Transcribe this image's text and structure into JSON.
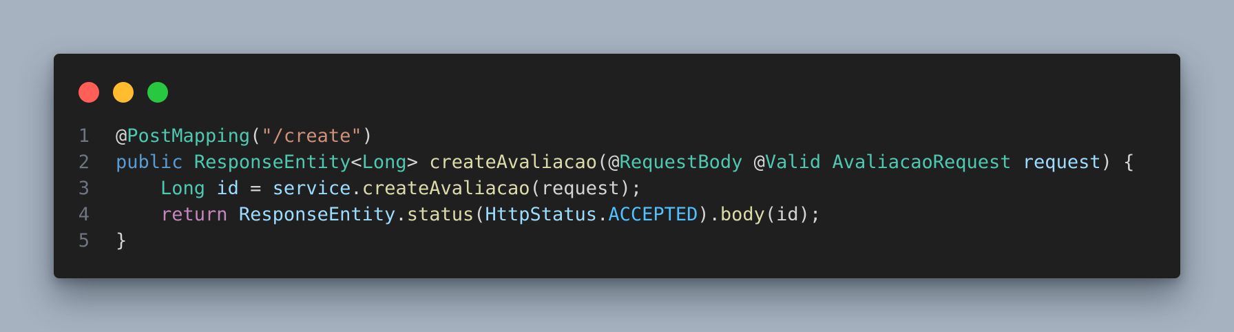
{
  "window": {
    "controls": [
      {
        "name": "close",
        "color": "#ff5f57"
      },
      {
        "name": "minimize",
        "color": "#febc2e"
      },
      {
        "name": "zoom",
        "color": "#28c840"
      }
    ]
  },
  "code": {
    "lines": [
      {
        "number": "1",
        "tokens": [
          {
            "text": "@",
            "color": "#d4d4d4"
          },
          {
            "text": "PostMapping",
            "color": "#4ec9b0"
          },
          {
            "text": "(",
            "color": "#d4d4d4"
          },
          {
            "text": "\"/create\"",
            "color": "#ce9178"
          },
          {
            "text": ")",
            "color": "#d4d4d4"
          }
        ]
      },
      {
        "number": "2",
        "tokens": [
          {
            "text": "public",
            "color": "#569cd6"
          },
          {
            "text": " ",
            "color": "#d4d4d4"
          },
          {
            "text": "ResponseEntity",
            "color": "#4ec9b0"
          },
          {
            "text": "<",
            "color": "#d4d4d4"
          },
          {
            "text": "Long",
            "color": "#4ec9b0"
          },
          {
            "text": "> ",
            "color": "#d4d4d4"
          },
          {
            "text": "createAvaliacao",
            "color": "#dcdcaa"
          },
          {
            "text": "(@",
            "color": "#d4d4d4"
          },
          {
            "text": "RequestBody",
            "color": "#4ec9b0"
          },
          {
            "text": " @",
            "color": "#d4d4d4"
          },
          {
            "text": "Valid",
            "color": "#4ec9b0"
          },
          {
            "text": " ",
            "color": "#d4d4d4"
          },
          {
            "text": "AvaliacaoRequest",
            "color": "#4ec9b0"
          },
          {
            "text": " ",
            "color": "#d4d4d4"
          },
          {
            "text": "request",
            "color": "#9cdcfe"
          },
          {
            "text": ") {",
            "color": "#d4d4d4"
          }
        ]
      },
      {
        "number": "3",
        "tokens": [
          {
            "text": "    ",
            "color": "#d4d4d4"
          },
          {
            "text": "Long",
            "color": "#4ec9b0"
          },
          {
            "text": " ",
            "color": "#d4d4d4"
          },
          {
            "text": "id",
            "color": "#9cdcfe"
          },
          {
            "text": " = ",
            "color": "#d4d4d4"
          },
          {
            "text": "service",
            "color": "#9cdcfe"
          },
          {
            "text": ".",
            "color": "#d4d4d4"
          },
          {
            "text": "createAvaliacao",
            "color": "#dcdcaa"
          },
          {
            "text": "(request);",
            "color": "#d4d4d4"
          }
        ]
      },
      {
        "number": "4",
        "tokens": [
          {
            "text": "    ",
            "color": "#d4d4d4"
          },
          {
            "text": "return",
            "color": "#c586c0"
          },
          {
            "text": " ",
            "color": "#d4d4d4"
          },
          {
            "text": "ResponseEntity",
            "color": "#9cdcfe"
          },
          {
            "text": ".",
            "color": "#d4d4d4"
          },
          {
            "text": "status",
            "color": "#dcdcaa"
          },
          {
            "text": "(",
            "color": "#d4d4d4"
          },
          {
            "text": "HttpStatus",
            "color": "#9cdcfe"
          },
          {
            "text": ".",
            "color": "#d4d4d4"
          },
          {
            "text": "ACCEPTED",
            "color": "#4fc1ff"
          },
          {
            "text": ").",
            "color": "#d4d4d4"
          },
          {
            "text": "body",
            "color": "#dcdcaa"
          },
          {
            "text": "(id);",
            "color": "#d4d4d4"
          }
        ]
      },
      {
        "number": "5",
        "tokens": [
          {
            "text": "}",
            "color": "#d4d4d4"
          }
        ]
      }
    ]
  }
}
